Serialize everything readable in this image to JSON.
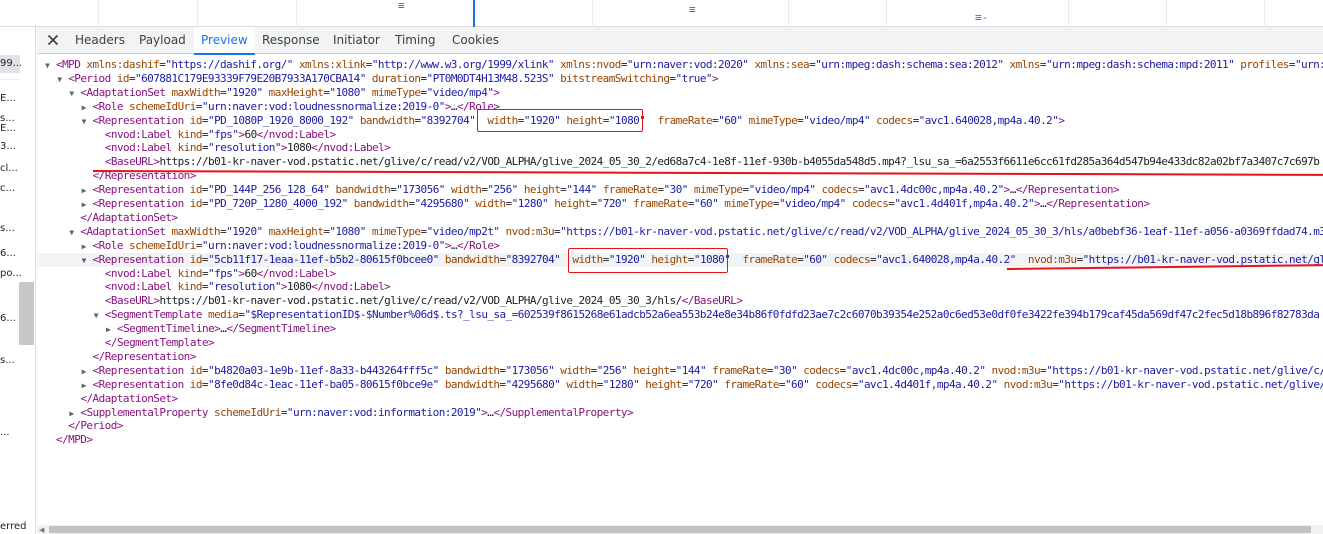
{
  "left_panel": {
    "fragments": [
      "99...",
      "E...",
      "s...",
      "E...",
      "3...",
      "cl...",
      "c...",
      "s...",
      "6...",
      "po...",
      "6...",
      "s...",
      "...",
      "erred"
    ]
  },
  "tabs": [
    "Headers",
    "Payload",
    "Preview",
    "Response",
    "Initiator",
    "Timing",
    "Cookies"
  ],
  "active_tab": "Preview",
  "xml_lines": [
    [
      [
        "t",
        "<MPD "
      ],
      [
        "a",
        "xmlns:dashif"
      ],
      [
        "x",
        "="
      ],
      [
        "v",
        "\"https://dashif.org/\""
      ],
      [
        "x",
        " "
      ],
      [
        "a",
        "xmlns:xlink"
      ],
      [
        "x",
        "="
      ],
      [
        "v",
        "\"http://www.w3.org/1999/xlink\""
      ],
      [
        "x",
        " "
      ],
      [
        "a",
        "xmlns:nvod"
      ],
      [
        "x",
        "="
      ],
      [
        "v",
        "\"urn:naver:vod:2020\""
      ],
      [
        "x",
        " "
      ],
      [
        "a",
        "xmlns:sea"
      ],
      [
        "x",
        "="
      ],
      [
        "v",
        "\"urn:mpeg:dash:schema:sea:2012\""
      ],
      [
        "x",
        " "
      ],
      [
        "a",
        "xmlns"
      ],
      [
        "x",
        "="
      ],
      [
        "v",
        "\"urn:mpeg:dash:schema:mpd:2011\""
      ],
      [
        "x",
        " "
      ],
      [
        "a",
        "profiles"
      ],
      [
        "x",
        "="
      ],
      [
        "v",
        "\"urn:mpeg"
      ]
    ],
    [
      [
        "t",
        "<Period "
      ],
      [
        "a",
        "id"
      ],
      [
        "x",
        "="
      ],
      [
        "v",
        "\"607881C179E93339F79E20B7933A170CBA14\""
      ],
      [
        "x",
        " "
      ],
      [
        "a",
        "duration"
      ],
      [
        "x",
        "="
      ],
      [
        "v",
        "\"PT0M0DT4H13M48.523S\""
      ],
      [
        "x",
        " "
      ],
      [
        "a",
        "bitstreamSwitching"
      ],
      [
        "x",
        "="
      ],
      [
        "v",
        "\"true\""
      ],
      [
        "t",
        ">"
      ]
    ],
    [
      [
        "t",
        "<AdaptationSet "
      ],
      [
        "a",
        "maxWidth"
      ],
      [
        "x",
        "="
      ],
      [
        "v",
        "\"1920\""
      ],
      [
        "x",
        " "
      ],
      [
        "a",
        "maxHeight"
      ],
      [
        "x",
        "="
      ],
      [
        "v",
        "\"1080\""
      ],
      [
        "x",
        " "
      ],
      [
        "a",
        "mimeType"
      ],
      [
        "x",
        "="
      ],
      [
        "v",
        "\"video/mp4\""
      ],
      [
        "t",
        ">"
      ]
    ],
    [
      [
        "t",
        "<Role "
      ],
      [
        "a",
        "schemeIdUri"
      ],
      [
        "x",
        "="
      ],
      [
        "v",
        "\"urn:naver:vod:loudnessnormalize:2019-0\""
      ],
      [
        "t",
        ">"
      ],
      [
        "x",
        "…"
      ],
      [
        "t",
        "</Role>"
      ]
    ],
    [
      [
        "t",
        "<Representation "
      ],
      [
        "a",
        "id"
      ],
      [
        "x",
        "="
      ],
      [
        "v",
        "\"PD_1080P_1920_8000_192\""
      ],
      [
        "x",
        " "
      ],
      [
        "a",
        "bandwidth"
      ],
      [
        "x",
        "="
      ],
      [
        "v",
        "\"8392704\""
      ],
      [
        "x",
        "  "
      ],
      [
        "a",
        "width"
      ],
      [
        "x",
        "="
      ],
      [
        "v",
        "\"1920\""
      ],
      [
        "x",
        " "
      ],
      [
        "a",
        "height"
      ],
      [
        "x",
        "="
      ],
      [
        "v",
        "\"1080\""
      ],
      [
        "x",
        "  "
      ],
      [
        "a",
        "frameRate"
      ],
      [
        "x",
        "="
      ],
      [
        "v",
        "\"60\""
      ],
      [
        "x",
        " "
      ],
      [
        "a",
        "mimeType"
      ],
      [
        "x",
        "="
      ],
      [
        "v",
        "\"video/mp4\""
      ],
      [
        "x",
        " "
      ],
      [
        "a",
        "codecs"
      ],
      [
        "x",
        "="
      ],
      [
        "v",
        "\"avc1.640028,mp4a.40.2\""
      ],
      [
        "t",
        ">"
      ]
    ],
    [
      [
        "t",
        "<nvod:Label "
      ],
      [
        "a",
        "kind"
      ],
      [
        "x",
        "="
      ],
      [
        "v",
        "\"fps\""
      ],
      [
        "t",
        ">"
      ],
      [
        "x",
        "60"
      ],
      [
        "t",
        "</nvod:Label>"
      ]
    ],
    [
      [
        "t",
        "<nvod:Label "
      ],
      [
        "a",
        "kind"
      ],
      [
        "x",
        "="
      ],
      [
        "v",
        "\"resolution\""
      ],
      [
        "t",
        ">"
      ],
      [
        "x",
        "1080"
      ],
      [
        "t",
        "</nvod:Label>"
      ]
    ],
    [
      [
        "t",
        "<BaseURL>"
      ],
      [
        "x",
        "https://b01-kr-naver-vod.pstatic.net/glive/c/read/v2/VOD_ALPHA/glive_2024_05_30_2/ed68a7c4-1e8f-11ef-930b-b4055da548d5.mp4?_lsu_sa_=6a2553f6611e6cc61fd285a364d547b94e433dc82a02bf7a3407c7c697b"
      ]
    ],
    [
      [
        "t",
        "</Representation>"
      ]
    ],
    [
      [
        "t",
        "<Representation "
      ],
      [
        "a",
        "id"
      ],
      [
        "x",
        "="
      ],
      [
        "v",
        "\"PD_144P_256_128_64\""
      ],
      [
        "x",
        " "
      ],
      [
        "a",
        "bandwidth"
      ],
      [
        "x",
        "="
      ],
      [
        "v",
        "\"173056\""
      ],
      [
        "x",
        " "
      ],
      [
        "a",
        "width"
      ],
      [
        "x",
        "="
      ],
      [
        "v",
        "\"256\""
      ],
      [
        "x",
        " "
      ],
      [
        "a",
        "height"
      ],
      [
        "x",
        "="
      ],
      [
        "v",
        "\"144\""
      ],
      [
        "x",
        " "
      ],
      [
        "a",
        "frameRate"
      ],
      [
        "x",
        "="
      ],
      [
        "v",
        "\"30\""
      ],
      [
        "x",
        " "
      ],
      [
        "a",
        "mimeType"
      ],
      [
        "x",
        "="
      ],
      [
        "v",
        "\"video/mp4\""
      ],
      [
        "x",
        " "
      ],
      [
        "a",
        "codecs"
      ],
      [
        "x",
        "="
      ],
      [
        "v",
        "\"avc1.4dc00c,mp4a.40.2\""
      ],
      [
        "t",
        ">"
      ],
      [
        "x",
        "…"
      ],
      [
        "t",
        "</Representation>"
      ]
    ],
    [
      [
        "t",
        "<Representation "
      ],
      [
        "a",
        "id"
      ],
      [
        "x",
        "="
      ],
      [
        "v",
        "\"PD_720P_1280_4000_192\""
      ],
      [
        "x",
        " "
      ],
      [
        "a",
        "bandwidth"
      ],
      [
        "x",
        "="
      ],
      [
        "v",
        "\"4295680\""
      ],
      [
        "x",
        " "
      ],
      [
        "a",
        "width"
      ],
      [
        "x",
        "="
      ],
      [
        "v",
        "\"1280\""
      ],
      [
        "x",
        " "
      ],
      [
        "a",
        "height"
      ],
      [
        "x",
        "="
      ],
      [
        "v",
        "\"720\""
      ],
      [
        "x",
        " "
      ],
      [
        "a",
        "frameRate"
      ],
      [
        "x",
        "="
      ],
      [
        "v",
        "\"60\""
      ],
      [
        "x",
        " "
      ],
      [
        "a",
        "mimeType"
      ],
      [
        "x",
        "="
      ],
      [
        "v",
        "\"video/mp4\""
      ],
      [
        "x",
        " "
      ],
      [
        "a",
        "codecs"
      ],
      [
        "x",
        "="
      ],
      [
        "v",
        "\"avc1.4d401f,mp4a.40.2\""
      ],
      [
        "t",
        ">"
      ],
      [
        "x",
        "…"
      ],
      [
        "t",
        "</Representation>"
      ]
    ],
    [
      [
        "t",
        "</AdaptationSet>"
      ]
    ],
    [
      [
        "t",
        "<AdaptationSet "
      ],
      [
        "a",
        "maxWidth"
      ],
      [
        "x",
        "="
      ],
      [
        "v",
        "\"1920\""
      ],
      [
        "x",
        " "
      ],
      [
        "a",
        "maxHeight"
      ],
      [
        "x",
        "="
      ],
      [
        "v",
        "\"1080\""
      ],
      [
        "x",
        " "
      ],
      [
        "a",
        "mimeType"
      ],
      [
        "x",
        "="
      ],
      [
        "v",
        "\"video/mp2t\""
      ],
      [
        "x",
        " "
      ],
      [
        "a",
        "nvod:m3u"
      ],
      [
        "x",
        "="
      ],
      [
        "v",
        "\"https://b01-kr-naver-vod.pstatic.net/glive/c/read/v2/VOD_ALPHA/glive_2024_05_30_3/hls/a0bebf36-1eaf-11ef-a056-a0369ffdad74.m3u"
      ]
    ],
    [
      [
        "t",
        "<Role "
      ],
      [
        "a",
        "schemeIdUri"
      ],
      [
        "x",
        "="
      ],
      [
        "v",
        "\"urn:naver:vod:loudnessnormalize:2019-0\""
      ],
      [
        "t",
        ">"
      ],
      [
        "x",
        "…"
      ],
      [
        "t",
        "</Role>"
      ]
    ],
    [
      [
        "t",
        "<Representation "
      ],
      [
        "a",
        "id"
      ],
      [
        "x",
        "="
      ],
      [
        "v",
        "\"5cb11f17-1eaa-11ef-b5b2-80615f0bcee0\""
      ],
      [
        "x",
        " "
      ],
      [
        "a",
        "bandwidth"
      ],
      [
        "x",
        "="
      ],
      [
        "v",
        "\"8392704\""
      ],
      [
        "x",
        "  "
      ],
      [
        "a",
        "width"
      ],
      [
        "x",
        "="
      ],
      [
        "v",
        "\"1920\""
      ],
      [
        "x",
        " "
      ],
      [
        "a",
        "height"
      ],
      [
        "x",
        "="
      ],
      [
        "v",
        "\"1080\""
      ],
      [
        "x",
        "  "
      ],
      [
        "a",
        "frameRate"
      ],
      [
        "x",
        "="
      ],
      [
        "v",
        "\"60\""
      ],
      [
        "x",
        " "
      ],
      [
        "a",
        "codecs"
      ],
      [
        "x",
        "="
      ],
      [
        "v",
        "\"avc1.640028,mp4a.40.2\""
      ],
      [
        "x",
        "  "
      ],
      [
        "a",
        "nvod:m3u"
      ],
      [
        "x",
        "="
      ],
      [
        "v",
        "\"https://b01-kr-naver-vod.pstatic.net/glive"
      ]
    ],
    [
      [
        "t",
        "<nvod:Label "
      ],
      [
        "a",
        "kind"
      ],
      [
        "x",
        "="
      ],
      [
        "v",
        "\"fps\""
      ],
      [
        "t",
        ">"
      ],
      [
        "x",
        "60"
      ],
      [
        "t",
        "</nvod:Label>"
      ]
    ],
    [
      [
        "t",
        "<nvod:Label "
      ],
      [
        "a",
        "kind"
      ],
      [
        "x",
        "="
      ],
      [
        "v",
        "\"resolution\""
      ],
      [
        "t",
        ">"
      ],
      [
        "x",
        "1080"
      ],
      [
        "t",
        "</nvod:Label>"
      ]
    ],
    [
      [
        "t",
        "<BaseURL>"
      ],
      [
        "x",
        "https://b01-kr-naver-vod.pstatic.net/glive/c/read/v2/VOD_ALPHA/glive_2024_05_30_3/hls/"
      ],
      [
        "t",
        "</BaseURL>"
      ]
    ],
    [
      [
        "t",
        "<SegmentTemplate "
      ],
      [
        "a",
        "media"
      ],
      [
        "x",
        "="
      ],
      [
        "v",
        "\"$RepresentationID$-$Number%06d$.ts?_lsu_sa_=602539f8615268e61adcb52a6ea553b24e8e34b86f0fdfd23ae7c2c6070b39354e252a0c6ed53e0df0fe3422fe394b179caf45da569df47c2fec5d18b896f82783da"
      ]
    ],
    [
      [
        "t",
        "<SegmentTimeline>"
      ],
      [
        "x",
        "…"
      ],
      [
        "t",
        "</SegmentTimeline>"
      ]
    ],
    [
      [
        "t",
        "</SegmentTemplate>"
      ]
    ],
    [
      [
        "t",
        "</Representation>"
      ]
    ],
    [
      [
        "t",
        "<Representation "
      ],
      [
        "a",
        "id"
      ],
      [
        "x",
        "="
      ],
      [
        "v",
        "\"b4820a03-1e9b-11ef-8a33-b443264fff5c\""
      ],
      [
        "x",
        " "
      ],
      [
        "a",
        "bandwidth"
      ],
      [
        "x",
        "="
      ],
      [
        "v",
        "\"173056\""
      ],
      [
        "x",
        " "
      ],
      [
        "a",
        "width"
      ],
      [
        "x",
        "="
      ],
      [
        "v",
        "\"256\""
      ],
      [
        "x",
        " "
      ],
      [
        "a",
        "height"
      ],
      [
        "x",
        "="
      ],
      [
        "v",
        "\"144\""
      ],
      [
        "x",
        " "
      ],
      [
        "a",
        "frameRate"
      ],
      [
        "x",
        "="
      ],
      [
        "v",
        "\"30\""
      ],
      [
        "x",
        " "
      ],
      [
        "a",
        "codecs"
      ],
      [
        "x",
        "="
      ],
      [
        "v",
        "\"avc1.4dc00c,mp4a.40.2\""
      ],
      [
        "x",
        " "
      ],
      [
        "a",
        "nvod:m3u"
      ],
      [
        "x",
        "="
      ],
      [
        "v",
        "\"https://b01-kr-naver-vod.pstatic.net/glive/c/"
      ]
    ],
    [
      [
        "t",
        "<Representation "
      ],
      [
        "a",
        "id"
      ],
      [
        "x",
        "="
      ],
      [
        "v",
        "\"8fe0d84c-1eac-11ef-ba05-80615f0bce9e\""
      ],
      [
        "x",
        " "
      ],
      [
        "a",
        "bandwidth"
      ],
      [
        "x",
        "="
      ],
      [
        "v",
        "\"4295680\""
      ],
      [
        "x",
        " "
      ],
      [
        "a",
        "width"
      ],
      [
        "x",
        "="
      ],
      [
        "v",
        "\"1280\""
      ],
      [
        "x",
        " "
      ],
      [
        "a",
        "height"
      ],
      [
        "x",
        "="
      ],
      [
        "v",
        "\"720\""
      ],
      [
        "x",
        " "
      ],
      [
        "a",
        "frameRate"
      ],
      [
        "x",
        "="
      ],
      [
        "v",
        "\"60\""
      ],
      [
        "x",
        " "
      ],
      [
        "a",
        "codecs"
      ],
      [
        "x",
        "="
      ],
      [
        "v",
        "\"avc1.4d401f,mp4a.40.2\""
      ],
      [
        "x",
        " "
      ],
      [
        "a",
        "nvod:m3u"
      ],
      [
        "x",
        "="
      ],
      [
        "v",
        "\"https://b01-kr-naver-vod.pstatic.net/glive/"
      ]
    ],
    [
      [
        "t",
        "</AdaptationSet>"
      ]
    ],
    [
      [
        "t",
        "<SupplementalProperty "
      ],
      [
        "a",
        "schemeIdUri"
      ],
      [
        "x",
        "="
      ],
      [
        "v",
        "\"urn:naver:vod:information:2019\""
      ],
      [
        "t",
        ">"
      ],
      [
        "x",
        "…"
      ],
      [
        "t",
        "</SupplementalProperty>"
      ]
    ],
    [
      [
        "t",
        "</Period>"
      ]
    ],
    [
      [
        "t",
        "</MPD>"
      ]
    ]
  ],
  "line_indent": [
    0,
    1,
    2,
    3,
    3,
    4,
    4,
    4,
    3,
    3,
    3,
    2,
    2,
    3,
    3,
    4,
    4,
    4,
    4,
    5,
    4,
    3,
    3,
    3,
    2,
    2,
    1,
    0
  ],
  "line_toggle": [
    "open",
    "open",
    "open",
    "closed",
    "open",
    "none",
    "none",
    "none",
    "none",
    "closed",
    "closed",
    "none",
    "open",
    "closed",
    "open",
    "none",
    "none",
    "none",
    "open",
    "closed",
    "none",
    "none",
    "closed",
    "closed",
    "none",
    "closed",
    "none",
    "none"
  ],
  "highlighted_line": 14,
  "annotation_color": "#e8121b"
}
